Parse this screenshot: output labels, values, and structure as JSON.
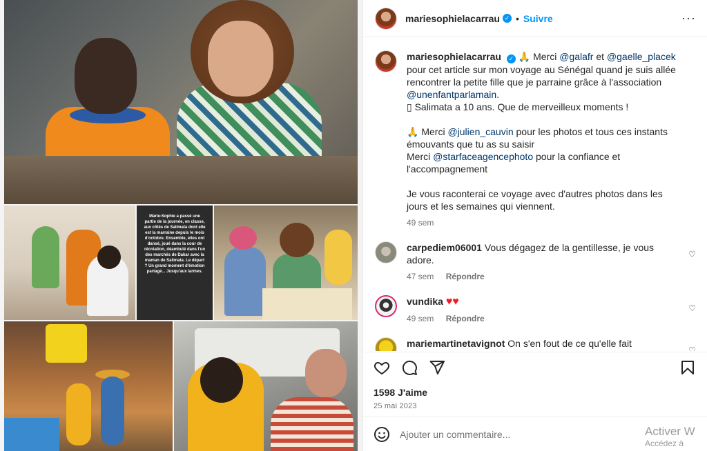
{
  "post": {
    "username": "mariesophielacarrau",
    "follow_label": "Suivre",
    "more_label": "···",
    "photo_caption_text": "Marie-Sophie a passé une partie de la journée, en classe, aux côtés de Salimata dont elle est la marraine depuis le mois d'octobre. Ensemble, elles ont dansé, joué dans la cour de récréation, déambulé dans l'un des marchés de Dakar avec la maman de Salimata. Le départ ? Un grand moment d'émotion partagé... Jusqu'aux larmes."
  },
  "caption": {
    "username": "mariesophielacarrau",
    "pray": "🙏",
    "line1_prefix": "Merci",
    "mention1": "@galafr",
    "and": "et",
    "mention2": "@gaelle_placek",
    "line2": "pour cet article sur mon voyage au Sénégal quand je suis allée rencontrer la petite fille que je parraine grâce à l'association",
    "mention3": "@unenfantparlamain",
    "line3_suffix": ".",
    "line4": "▯ Salimata a 10 ans. Que de merveilleux moments !",
    "line5_prefix": "Merci",
    "mention4": "@julien_cauvin",
    "line5_rest": "pour les photos et tous ces instants émouvants que tu as su saisir",
    "line6_prefix": "Merci",
    "mention5": "@starfaceagencephoto",
    "line6_rest": "pour la confiance et l'accompagnement",
    "line7": "Je vous raconterai ce voyage avec d'autres photos dans les jours et les semaines qui viennent.",
    "time": "49 sem"
  },
  "comments": [
    {
      "username": "carpediem06001",
      "text": "Vous dégagez de la gentillesse, je vous adore.",
      "time": "47 sem",
      "reply": "Répondre"
    },
    {
      "username": "vundika",
      "text": "♥♥",
      "time": "49 sem",
      "reply": "Répondre"
    },
    {
      "username": "mariemartinetavignot",
      "text": "On s'en fout de ce qu'elle fait"
    }
  ],
  "actions": {
    "likes": "1598 J'aime",
    "date": "25 mai 2023"
  },
  "composer": {
    "placeholder": "Ajouter un commentaire..."
  },
  "watermark": {
    "line1": "Activer W",
    "line2": "Accédez à"
  },
  "colors": {
    "link": "#0095f6",
    "mention": "#00376b",
    "muted": "#737373",
    "heart_red": "#ed1c24"
  }
}
